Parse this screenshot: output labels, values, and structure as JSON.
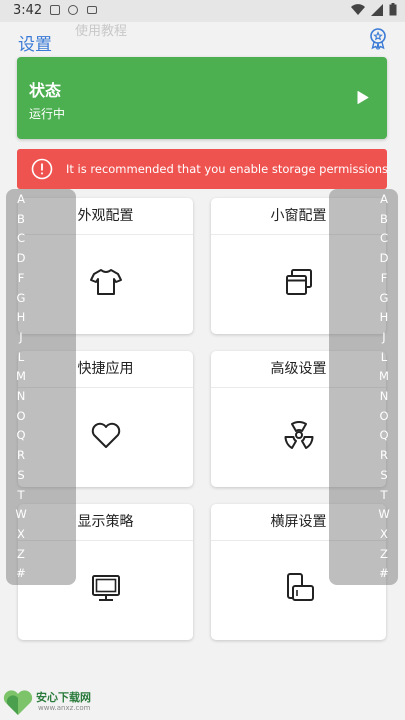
{
  "status_bar": {
    "time": "3:42"
  },
  "app_bar": {
    "title": "设置",
    "ghost_text": "使用教程"
  },
  "status_card": {
    "title": "状态",
    "subtitle": "运行中",
    "color": "#4caf50"
  },
  "alert": {
    "text": "It is recommended that you enable storage permissions",
    "color": "#ef5350"
  },
  "tiles": [
    {
      "label": "外观配置",
      "icon": "tshirt-icon"
    },
    {
      "label": "小窗配置",
      "icon": "windows-icon"
    },
    {
      "label": "快捷应用",
      "icon": "heart-icon"
    },
    {
      "label": "高级设置",
      "icon": "radiation-icon"
    },
    {
      "label": "显示策略",
      "icon": "monitor-icon"
    },
    {
      "label": "横屏设置",
      "icon": "rotate-screen-icon"
    }
  ],
  "index_letters": [
    "A",
    "B",
    "C",
    "D",
    "F",
    "G",
    "H",
    "J",
    "L",
    "M",
    "N",
    "O",
    "Q",
    "R",
    "S",
    "T",
    "W",
    "X",
    "Z",
    "#"
  ],
  "watermark": {
    "title": "安心下载网",
    "subtitle": "www.anxz.com",
    "logo_text": "安心下载"
  },
  "colors": {
    "accent": "#3b7bd6",
    "background": "#f2f2f2"
  }
}
